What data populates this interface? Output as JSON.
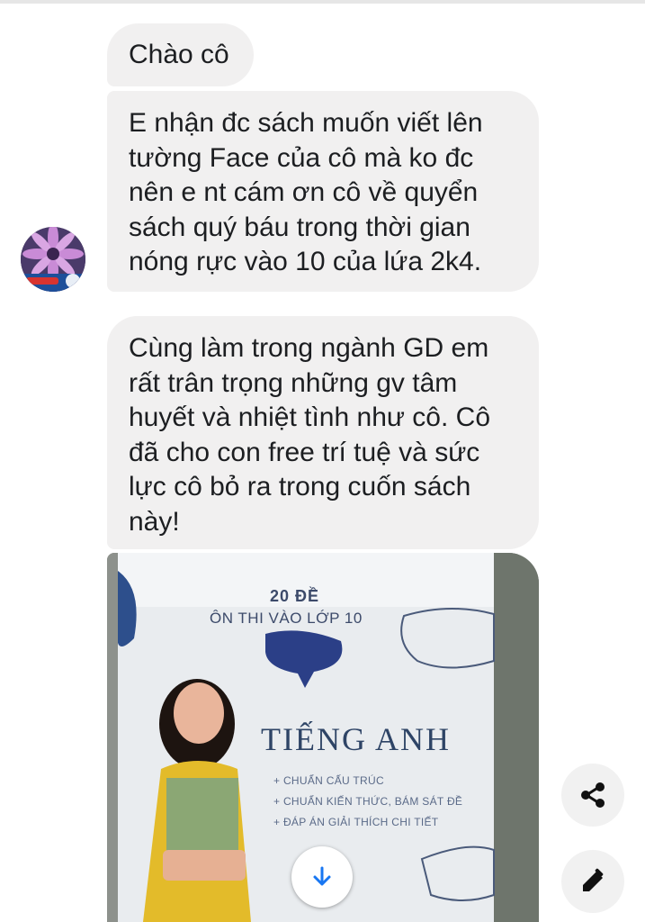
{
  "conversation": {
    "messages": [
      {
        "lines": [
          "Chào cô"
        ]
      },
      {
        "lines": [
          "E nhận đc sách muốn viết lên",
          "tường Face của cô mà ko đc",
          "nên e nt cám ơn cô về quyển",
          "sách quý báu trong thời gian",
          "nóng rực vào 10 của lứa 2k4."
        ]
      },
      {
        "lines": [
          "Cùng làm trong ngành GD em",
          "rất trân trọng những gv tâm",
          "huyết và nhiệt tình như cô. Cô",
          "đã cho con free trí tuệ và sức",
          "lực cô bỏ ra trong cuốn sách",
          "này!"
        ]
      }
    ],
    "photo": {
      "cover_line1": "20 ĐỀ",
      "cover_line2": "ÔN THI VÀO LỚP 10",
      "cover_title": "TIẾNG ANH",
      "bullets": [
        "+ CHUẨN CẤU TRÚC",
        "+ CHUẨN KIẾN THỨC, BÁM SÁT ĐỀ",
        "+ ĐÁP ÁN GIẢI THÍCH CHI TIẾT"
      ]
    }
  },
  "icons": {
    "download": "arrow-down-icon",
    "share": "share-icon",
    "edit": "pencil-icon"
  },
  "colors": {
    "bubble_bg": "#f1f0f0",
    "text": "#1c1e21",
    "download_arrow": "#1877f2"
  }
}
